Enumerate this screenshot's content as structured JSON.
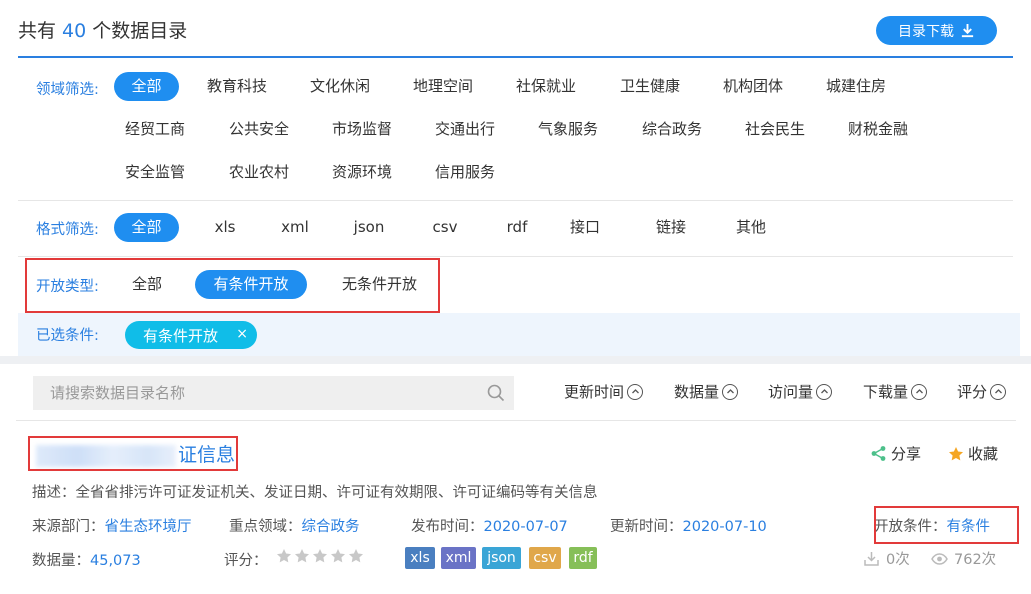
{
  "header": {
    "title_prefix": "共有",
    "count": "40",
    "title_suffix": "个数据目录",
    "download_label": "目录下载"
  },
  "filters": {
    "domain": {
      "label": "领域筛选:",
      "items": [
        "全部",
        "教育科技",
        "文化休闲",
        "地理空间",
        "社保就业",
        "卫生健康",
        "机构团体",
        "城建住房",
        "经贸工商",
        "公共安全",
        "市场监督",
        "交通出行",
        "气象服务",
        "综合政务",
        "社会民生",
        "财税金融",
        "安全监管",
        "农业农村",
        "资源环境",
        "信用服务"
      ],
      "active": "全部"
    },
    "format": {
      "label": "格式筛选:",
      "items": [
        "全部",
        "xls",
        "xml",
        "json",
        "csv",
        "rdf",
        "接口",
        "链接",
        "其他"
      ],
      "active": "全部"
    },
    "open_type": {
      "label": "开放类型:",
      "items": [
        "全部",
        "有条件开放",
        "无条件开放"
      ],
      "active": "有条件开放"
    },
    "selected": {
      "label": "已选条件:",
      "chip": "有条件开放",
      "chip_close": "×"
    }
  },
  "search": {
    "placeholder": "请搜索数据目录名称"
  },
  "sort": {
    "items": [
      "更新时间",
      "数据量",
      "访问量",
      "下载量",
      "评分"
    ]
  },
  "dataset": {
    "title": "证信息",
    "share_label": "分享",
    "fav_label": "收藏",
    "desc": "描述：全省省排污许可证发证机关、发证日期、许可证有效期限、许可证编码等有关信息",
    "source_label": "来源部门：",
    "source_value": "省生态环境厅",
    "domain_label": "重点领域：",
    "domain_value": "综合政务",
    "publish_label": "发布时间：",
    "publish_value": "2020-07-07",
    "update_label": "更新时间：",
    "update_value": "2020-07-10",
    "open_label": "开放条件：",
    "open_value": "有条件",
    "volume_label": "数据量：",
    "volume_value": "45,073",
    "rating_label": "评分：",
    "rating_stars": 0,
    "formats": [
      {
        "name": "xls",
        "color": "#4a7fc0"
      },
      {
        "name": "xml",
        "color": "#6a73c6"
      },
      {
        "name": "json",
        "color": "#3aa5d6"
      },
      {
        "name": "csv",
        "color": "#e0a74a"
      },
      {
        "name": "rdf",
        "color": "#86bf58"
      }
    ],
    "downloads": "0次",
    "views": "762次"
  },
  "colors": {
    "accent": "#1f8ef0",
    "link": "#2a7fe0",
    "highlight_box": "#e23a3a",
    "chip": "#10bde8"
  }
}
